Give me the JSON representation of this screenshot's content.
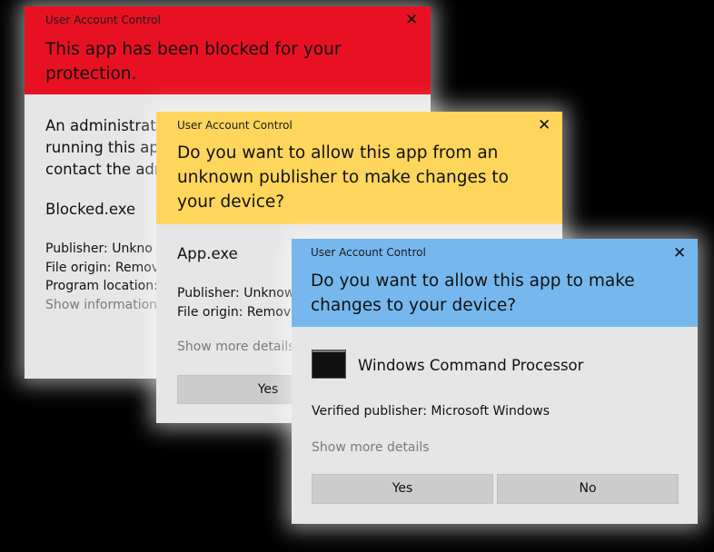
{
  "blocked_dialog": {
    "window_title": "User Account Control",
    "heading": "This app has been blocked for your protection.",
    "message_lines": [
      "An administrato",
      "running this app",
      "contact the adm"
    ],
    "app_name": "Blocked.exe",
    "details": [
      "Publisher: Unkno",
      "File origin: Remova",
      "Program location:"
    ],
    "show_info_link": "Show information",
    "header_color": "#e81123"
  },
  "unknown_publisher_dialog": {
    "window_title": "User Account Control",
    "heading": "Do you want to allow this app from an unknown publisher to make changes to your device?",
    "app_name": "App.exe",
    "details": [
      "Publisher: Unknown",
      "File origin: Remova"
    ],
    "show_more_link": "Show more details",
    "yes_label": "Yes",
    "header_color": "#fed65c"
  },
  "verified_dialog": {
    "window_title": "User Account Control",
    "heading": "Do you want to allow this app to make changes to your device?",
    "app_name": "Windows Command Processor",
    "publisher": "Verified publisher: Microsoft Windows",
    "show_more_link": "Show more details",
    "yes_label": "Yes",
    "no_label": "No",
    "header_color": "#76b8ee"
  },
  "icons": {
    "close": "close-icon",
    "app": "command-prompt-icon"
  },
  "close_glyph": "✕"
}
